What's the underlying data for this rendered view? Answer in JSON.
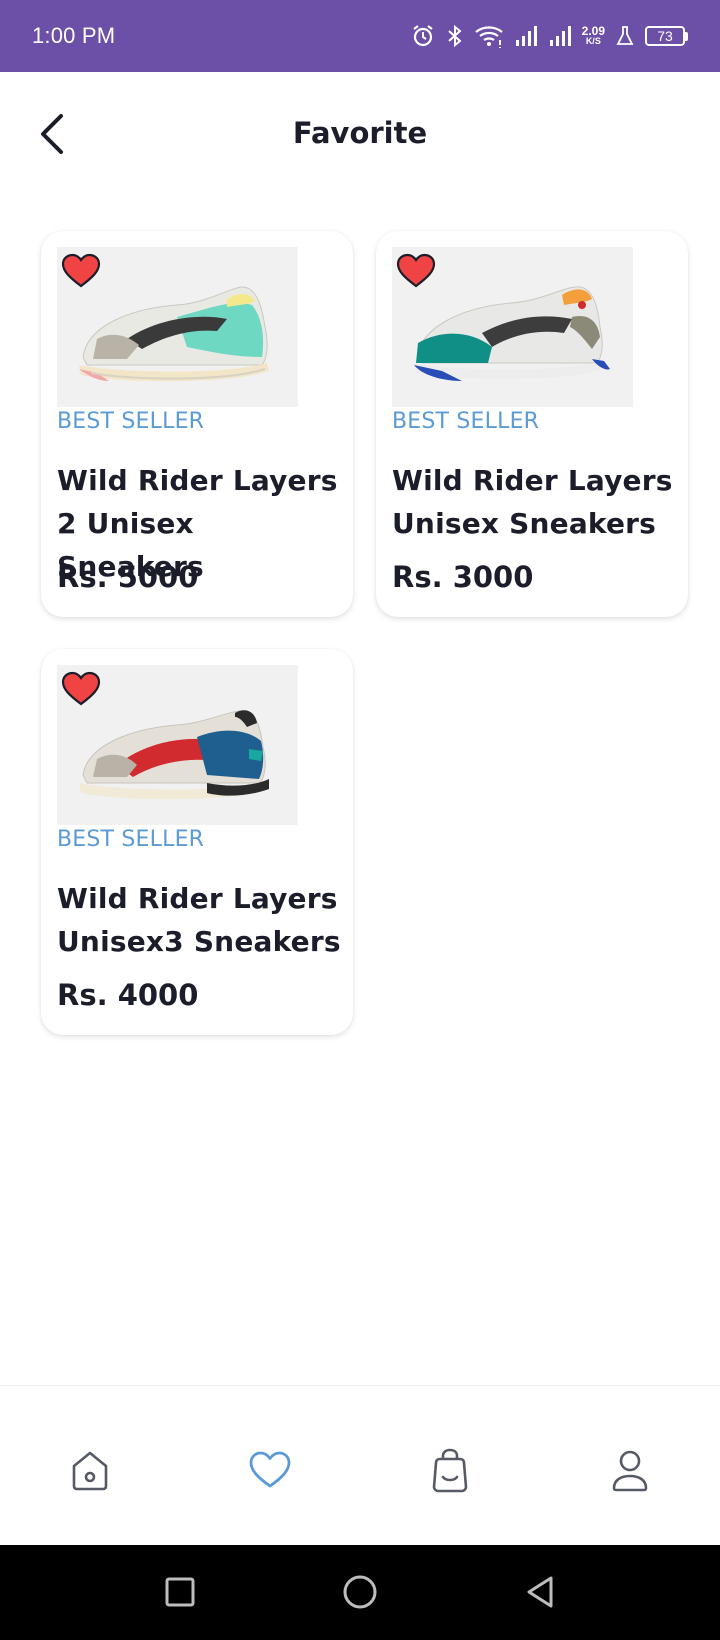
{
  "status_bar": {
    "time": "1:00 PM",
    "net_speed_value": "2.09",
    "net_speed_unit": "K/S",
    "battery": "73",
    "icons": [
      "alarm-icon",
      "bluetooth-icon",
      "wifi-icon",
      "signal-icon",
      "signal-icon",
      "lab-icon",
      "battery-icon"
    ]
  },
  "header": {
    "title": "Favorite",
    "back_icon": "chevron-left-icon"
  },
  "products": [
    {
      "badge": "BEST SELLER",
      "name": "Wild Rider Layers 2 Unisex Sneakers",
      "price": "Rs. 5000",
      "favorite": true,
      "colors": {
        "upper": "#e9e9e4",
        "accent": "#6fd8c3",
        "stripe": "#3a3a3a",
        "sole": "#f3e6c8",
        "trim": "#f2a8a8"
      }
    },
    {
      "badge": "BEST SELLER",
      "name": "Wild Rider Layers Unisex Sneakers",
      "price": "Rs. 3000",
      "favorite": true,
      "colors": {
        "upper": "#e8e8e6",
        "accent": "#0f8f86",
        "stripe": "#3d3d3d",
        "sole": "#ededed",
        "trim": "#2a4db8"
      }
    },
    {
      "badge": "BEST SELLER",
      "name": "Wild Rider Layers Unisex3 Sneakers",
      "price": "Rs. 4000",
      "favorite": true,
      "colors": {
        "upper": "#e4e0d8",
        "accent": "#d12a2f",
        "stripe": "#1f5f8f",
        "sole": "#f1ead6",
        "trim": "#2b2b2b"
      }
    }
  ],
  "bottom_nav": [
    {
      "name": "home",
      "icon": "home-icon",
      "active": false
    },
    {
      "name": "favorite",
      "icon": "heart-icon",
      "active": true
    },
    {
      "name": "cart",
      "icon": "shopping-bag-icon",
      "active": false
    },
    {
      "name": "profile",
      "icon": "user-icon",
      "active": false
    }
  ],
  "theme": {
    "status_bar": "#6c4fa6",
    "badge_blue": "#5b9bd5",
    "heart_red": "#f04444",
    "nav_active": "#5b9bd5",
    "nav_inactive": "#555a66"
  }
}
